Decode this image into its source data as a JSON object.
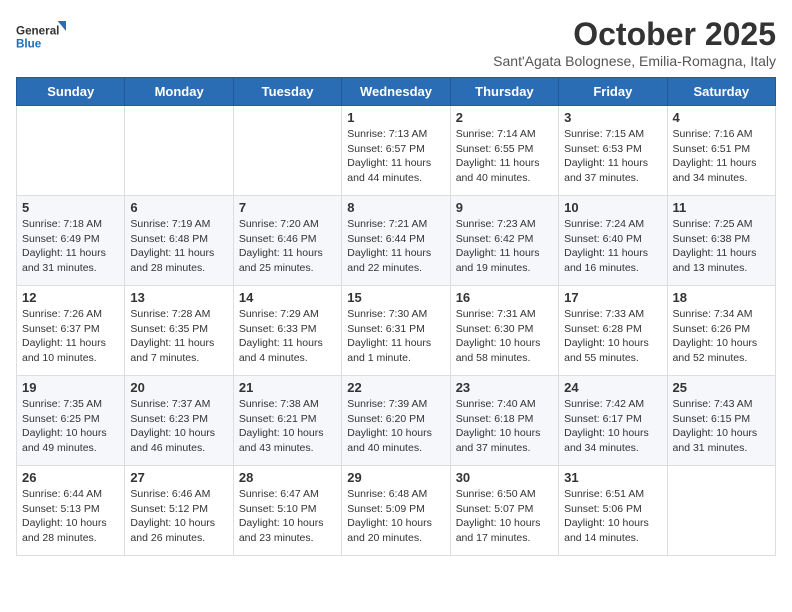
{
  "logo": {
    "line1": "General",
    "line2": "Blue"
  },
  "title": "October 2025",
  "location": "Sant'Agata Bolognese, Emilia-Romagna, Italy",
  "weekdays": [
    "Sunday",
    "Monday",
    "Tuesday",
    "Wednesday",
    "Thursday",
    "Friday",
    "Saturday"
  ],
  "weeks": [
    [
      {
        "day": "",
        "content": ""
      },
      {
        "day": "",
        "content": ""
      },
      {
        "day": "",
        "content": ""
      },
      {
        "day": "1",
        "content": "Sunrise: 7:13 AM\nSunset: 6:57 PM\nDaylight: 11 hours\nand 44 minutes."
      },
      {
        "day": "2",
        "content": "Sunrise: 7:14 AM\nSunset: 6:55 PM\nDaylight: 11 hours\nand 40 minutes."
      },
      {
        "day": "3",
        "content": "Sunrise: 7:15 AM\nSunset: 6:53 PM\nDaylight: 11 hours\nand 37 minutes."
      },
      {
        "day": "4",
        "content": "Sunrise: 7:16 AM\nSunset: 6:51 PM\nDaylight: 11 hours\nand 34 minutes."
      }
    ],
    [
      {
        "day": "5",
        "content": "Sunrise: 7:18 AM\nSunset: 6:49 PM\nDaylight: 11 hours\nand 31 minutes."
      },
      {
        "day": "6",
        "content": "Sunrise: 7:19 AM\nSunset: 6:48 PM\nDaylight: 11 hours\nand 28 minutes."
      },
      {
        "day": "7",
        "content": "Sunrise: 7:20 AM\nSunset: 6:46 PM\nDaylight: 11 hours\nand 25 minutes."
      },
      {
        "day": "8",
        "content": "Sunrise: 7:21 AM\nSunset: 6:44 PM\nDaylight: 11 hours\nand 22 minutes."
      },
      {
        "day": "9",
        "content": "Sunrise: 7:23 AM\nSunset: 6:42 PM\nDaylight: 11 hours\nand 19 minutes."
      },
      {
        "day": "10",
        "content": "Sunrise: 7:24 AM\nSunset: 6:40 PM\nDaylight: 11 hours\nand 16 minutes."
      },
      {
        "day": "11",
        "content": "Sunrise: 7:25 AM\nSunset: 6:38 PM\nDaylight: 11 hours\nand 13 minutes."
      }
    ],
    [
      {
        "day": "12",
        "content": "Sunrise: 7:26 AM\nSunset: 6:37 PM\nDaylight: 11 hours\nand 10 minutes."
      },
      {
        "day": "13",
        "content": "Sunrise: 7:28 AM\nSunset: 6:35 PM\nDaylight: 11 hours\nand 7 minutes."
      },
      {
        "day": "14",
        "content": "Sunrise: 7:29 AM\nSunset: 6:33 PM\nDaylight: 11 hours\nand 4 minutes."
      },
      {
        "day": "15",
        "content": "Sunrise: 7:30 AM\nSunset: 6:31 PM\nDaylight: 11 hours\nand 1 minute."
      },
      {
        "day": "16",
        "content": "Sunrise: 7:31 AM\nSunset: 6:30 PM\nDaylight: 10 hours\nand 58 minutes."
      },
      {
        "day": "17",
        "content": "Sunrise: 7:33 AM\nSunset: 6:28 PM\nDaylight: 10 hours\nand 55 minutes."
      },
      {
        "day": "18",
        "content": "Sunrise: 7:34 AM\nSunset: 6:26 PM\nDaylight: 10 hours\nand 52 minutes."
      }
    ],
    [
      {
        "day": "19",
        "content": "Sunrise: 7:35 AM\nSunset: 6:25 PM\nDaylight: 10 hours\nand 49 minutes."
      },
      {
        "day": "20",
        "content": "Sunrise: 7:37 AM\nSunset: 6:23 PM\nDaylight: 10 hours\nand 46 minutes."
      },
      {
        "day": "21",
        "content": "Sunrise: 7:38 AM\nSunset: 6:21 PM\nDaylight: 10 hours\nand 43 minutes."
      },
      {
        "day": "22",
        "content": "Sunrise: 7:39 AM\nSunset: 6:20 PM\nDaylight: 10 hours\nand 40 minutes."
      },
      {
        "day": "23",
        "content": "Sunrise: 7:40 AM\nSunset: 6:18 PM\nDaylight: 10 hours\nand 37 minutes."
      },
      {
        "day": "24",
        "content": "Sunrise: 7:42 AM\nSunset: 6:17 PM\nDaylight: 10 hours\nand 34 minutes."
      },
      {
        "day": "25",
        "content": "Sunrise: 7:43 AM\nSunset: 6:15 PM\nDaylight: 10 hours\nand 31 minutes."
      }
    ],
    [
      {
        "day": "26",
        "content": "Sunrise: 6:44 AM\nSunset: 5:13 PM\nDaylight: 10 hours\nand 28 minutes."
      },
      {
        "day": "27",
        "content": "Sunrise: 6:46 AM\nSunset: 5:12 PM\nDaylight: 10 hours\nand 26 minutes."
      },
      {
        "day": "28",
        "content": "Sunrise: 6:47 AM\nSunset: 5:10 PM\nDaylight: 10 hours\nand 23 minutes."
      },
      {
        "day": "29",
        "content": "Sunrise: 6:48 AM\nSunset: 5:09 PM\nDaylight: 10 hours\nand 20 minutes."
      },
      {
        "day": "30",
        "content": "Sunrise: 6:50 AM\nSunset: 5:07 PM\nDaylight: 10 hours\nand 17 minutes."
      },
      {
        "day": "31",
        "content": "Sunrise: 6:51 AM\nSunset: 5:06 PM\nDaylight: 10 hours\nand 14 minutes."
      },
      {
        "day": "",
        "content": ""
      }
    ]
  ]
}
